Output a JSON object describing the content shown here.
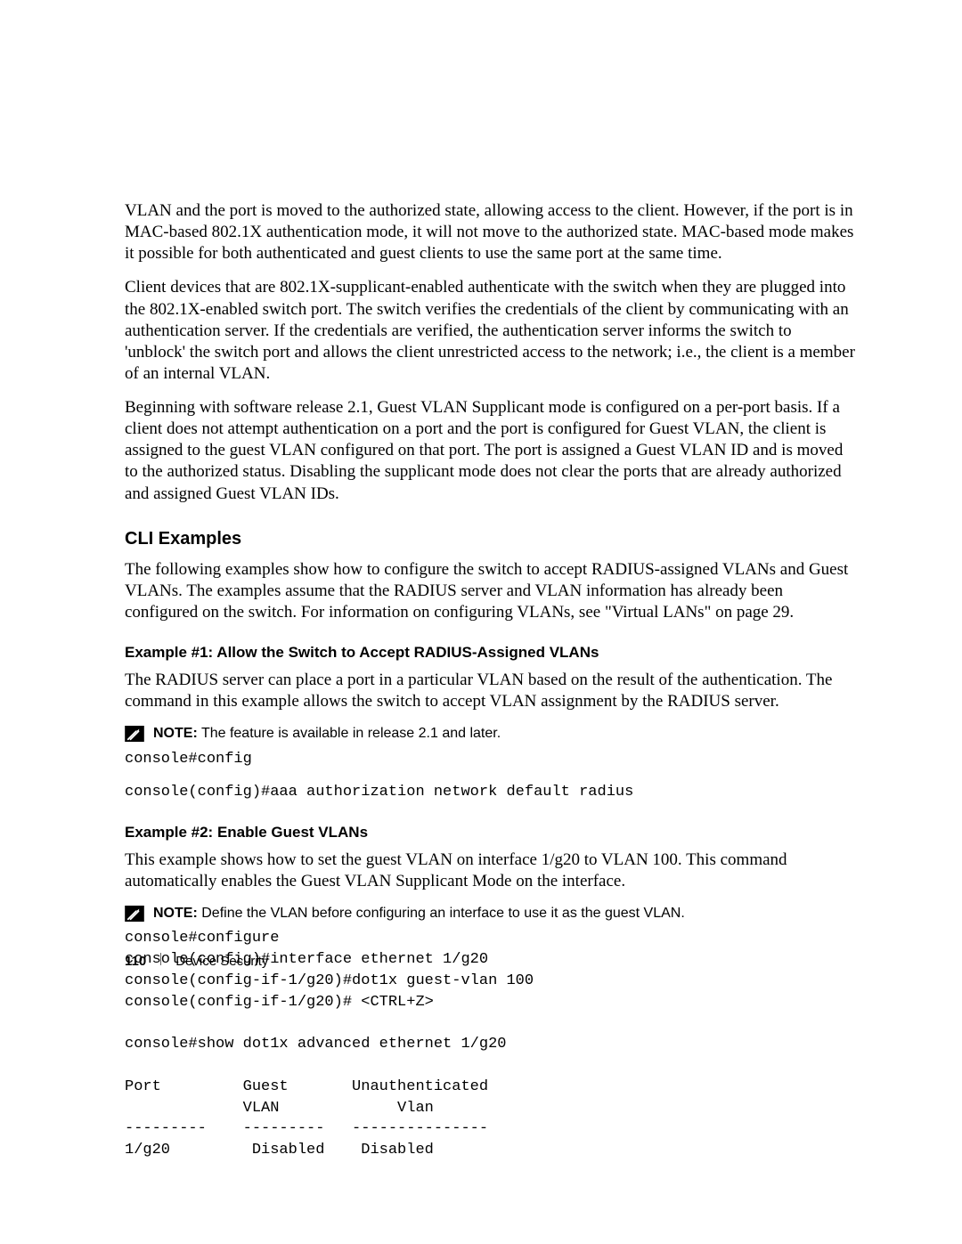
{
  "paragraphs": {
    "p1": "VLAN and the port is moved to the authorized state, allowing access to the client. However, if the port is in MAC-based 802.1X authentication mode, it will not move to the authorized state. MAC-based mode makes it possible for both authenticated and guest clients to use the same port at the same time.",
    "p2": "Client devices that are 802.1X-supplicant-enabled authenticate with the switch when they are plugged into the 802.1X-enabled switch port. The switch verifies the credentials of the client by communicating with an authentication server. If the credentials are verified, the authentication server informs the switch to 'unblock' the switch port and allows the client unrestricted access to the network; i.e., the client is a member of an internal VLAN.",
    "p3": "Beginning with software release 2.1, Guest VLAN Supplicant mode is configured on a per-port basis. If a client does not attempt authentication on a port and the port is configured for Guest VLAN, the client is assigned to the guest VLAN configured on that port. The port is assigned a Guest VLAN ID and is moved to the authorized status. Disabling the supplicant mode does not clear the ports that are already authorized and assigned Guest VLAN IDs."
  },
  "headings": {
    "cli": "CLI Examples",
    "ex1": "Example #1: Allow the Switch to Accept RADIUS-Assigned VLANs",
    "ex2": "Example #2: Enable Guest VLANs"
  },
  "cli_intro": "The following examples show how to configure the switch to accept RADIUS-assigned VLANs and Guest VLANs. The examples assume that the RADIUS server and VLAN information has already been configured on the switch. For information on configuring VLANs, see \"Virtual LANs\" on page 29.",
  "ex1_text": "The RADIUS server can place a port in a particular VLAN based on the result of the authentication. The command in this example allows the switch to accept VLAN assignment by the RADIUS server.",
  "ex2_text": "This example shows how to set the guest VLAN on interface 1/g20 to VLAN 100. This command automatically enables the Guest VLAN Supplicant Mode on the interface.",
  "notes": {
    "label": "NOTE:",
    "n1": "The feature is available in release 2.1 and later.",
    "n2": "Define the VLAN before configuring an interface to use it as the guest VLAN."
  },
  "code": {
    "c1": "console#config",
    "c2": "console(config)#aaa authorization network default radius",
    "c3": "console#configure\nconsole(config)#interface ethernet 1/g20\nconsole(config-if-1/g20)#dot1x guest-vlan 100\nconsole(config-if-1/g20)# <CTRL+Z>\n\nconsole#show dot1x advanced ethernet 1/g20\n\nPort         Guest       Unauthenticated\n             VLAN             Vlan\n---------    ---------   ---------------\n1/g20         Disabled    Disabled"
  },
  "footer": {
    "page": "110",
    "section": "Device Security"
  }
}
